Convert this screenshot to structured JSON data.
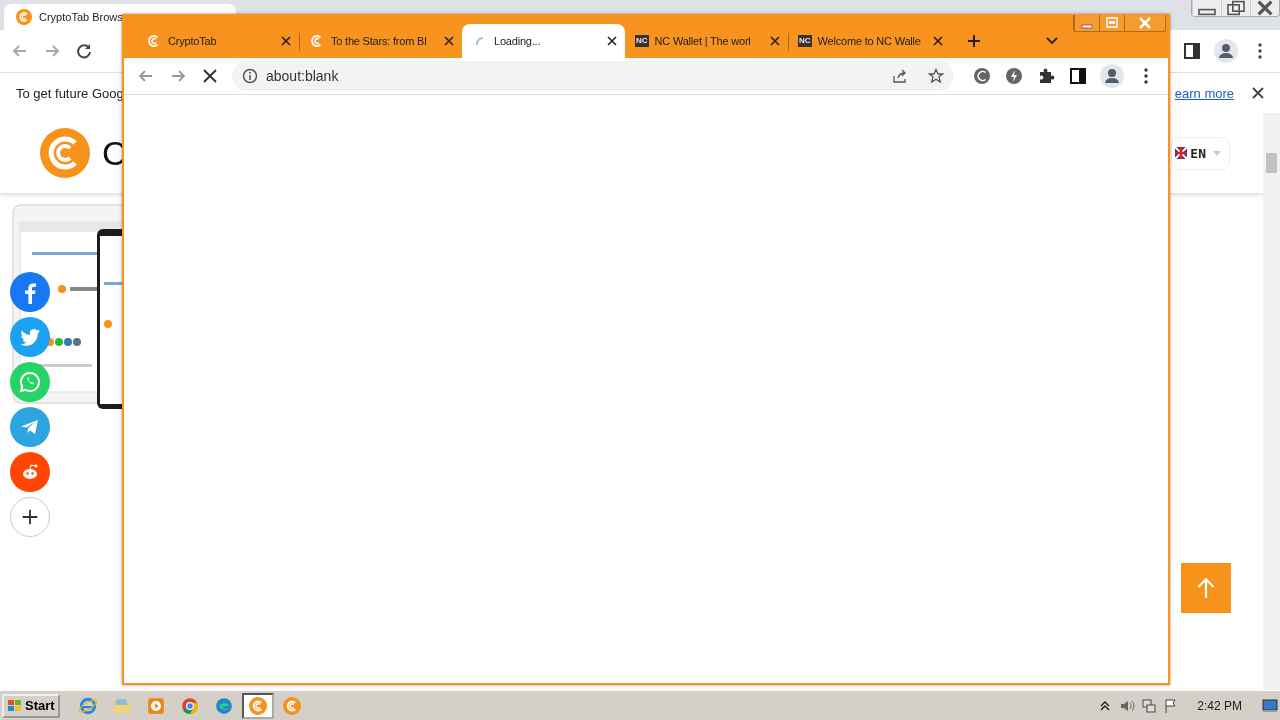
{
  "background_browser": {
    "tab": {
      "title": "CryptoTab Brows",
      "selected": true
    },
    "infobar": {
      "text": "To get future Goog",
      "link": "earn more"
    },
    "site": {
      "logo_text": "C",
      "language": "EN"
    },
    "share_buttons": [
      {
        "kind": "facebook"
      },
      {
        "kind": "twitter"
      },
      {
        "kind": "whatsapp"
      },
      {
        "kind": "telegram"
      },
      {
        "kind": "reddit"
      },
      {
        "kind": "more"
      }
    ]
  },
  "window": {
    "tabs": [
      {
        "title": "CryptoTab",
        "kind": "cryptotab",
        "selected": false
      },
      {
        "title": "To the Stars: from Bl",
        "kind": "cryptotab",
        "selected": false
      },
      {
        "title": "Loading...",
        "kind": "loading",
        "selected": true
      },
      {
        "title": "NC Wallet | The worl",
        "kind": "nc",
        "badge": "NC",
        "selected": false
      },
      {
        "title": "Welcome to NC Walle",
        "kind": "nc",
        "badge": "NC",
        "selected": false
      }
    ],
    "address": "about:blank",
    "loading": true
  },
  "taskbar": {
    "start": "Start",
    "apps": [
      {
        "kind": "ie",
        "selected": false
      },
      {
        "kind": "folder",
        "selected": false
      },
      {
        "kind": "media",
        "selected": false
      },
      {
        "kind": "chrome",
        "selected": false
      },
      {
        "kind": "edge",
        "selected": false
      },
      {
        "kind": "cryptotab",
        "selected": true
      },
      {
        "kind": "cryptotab",
        "selected": false
      }
    ],
    "clock": "2:42 PM"
  }
}
